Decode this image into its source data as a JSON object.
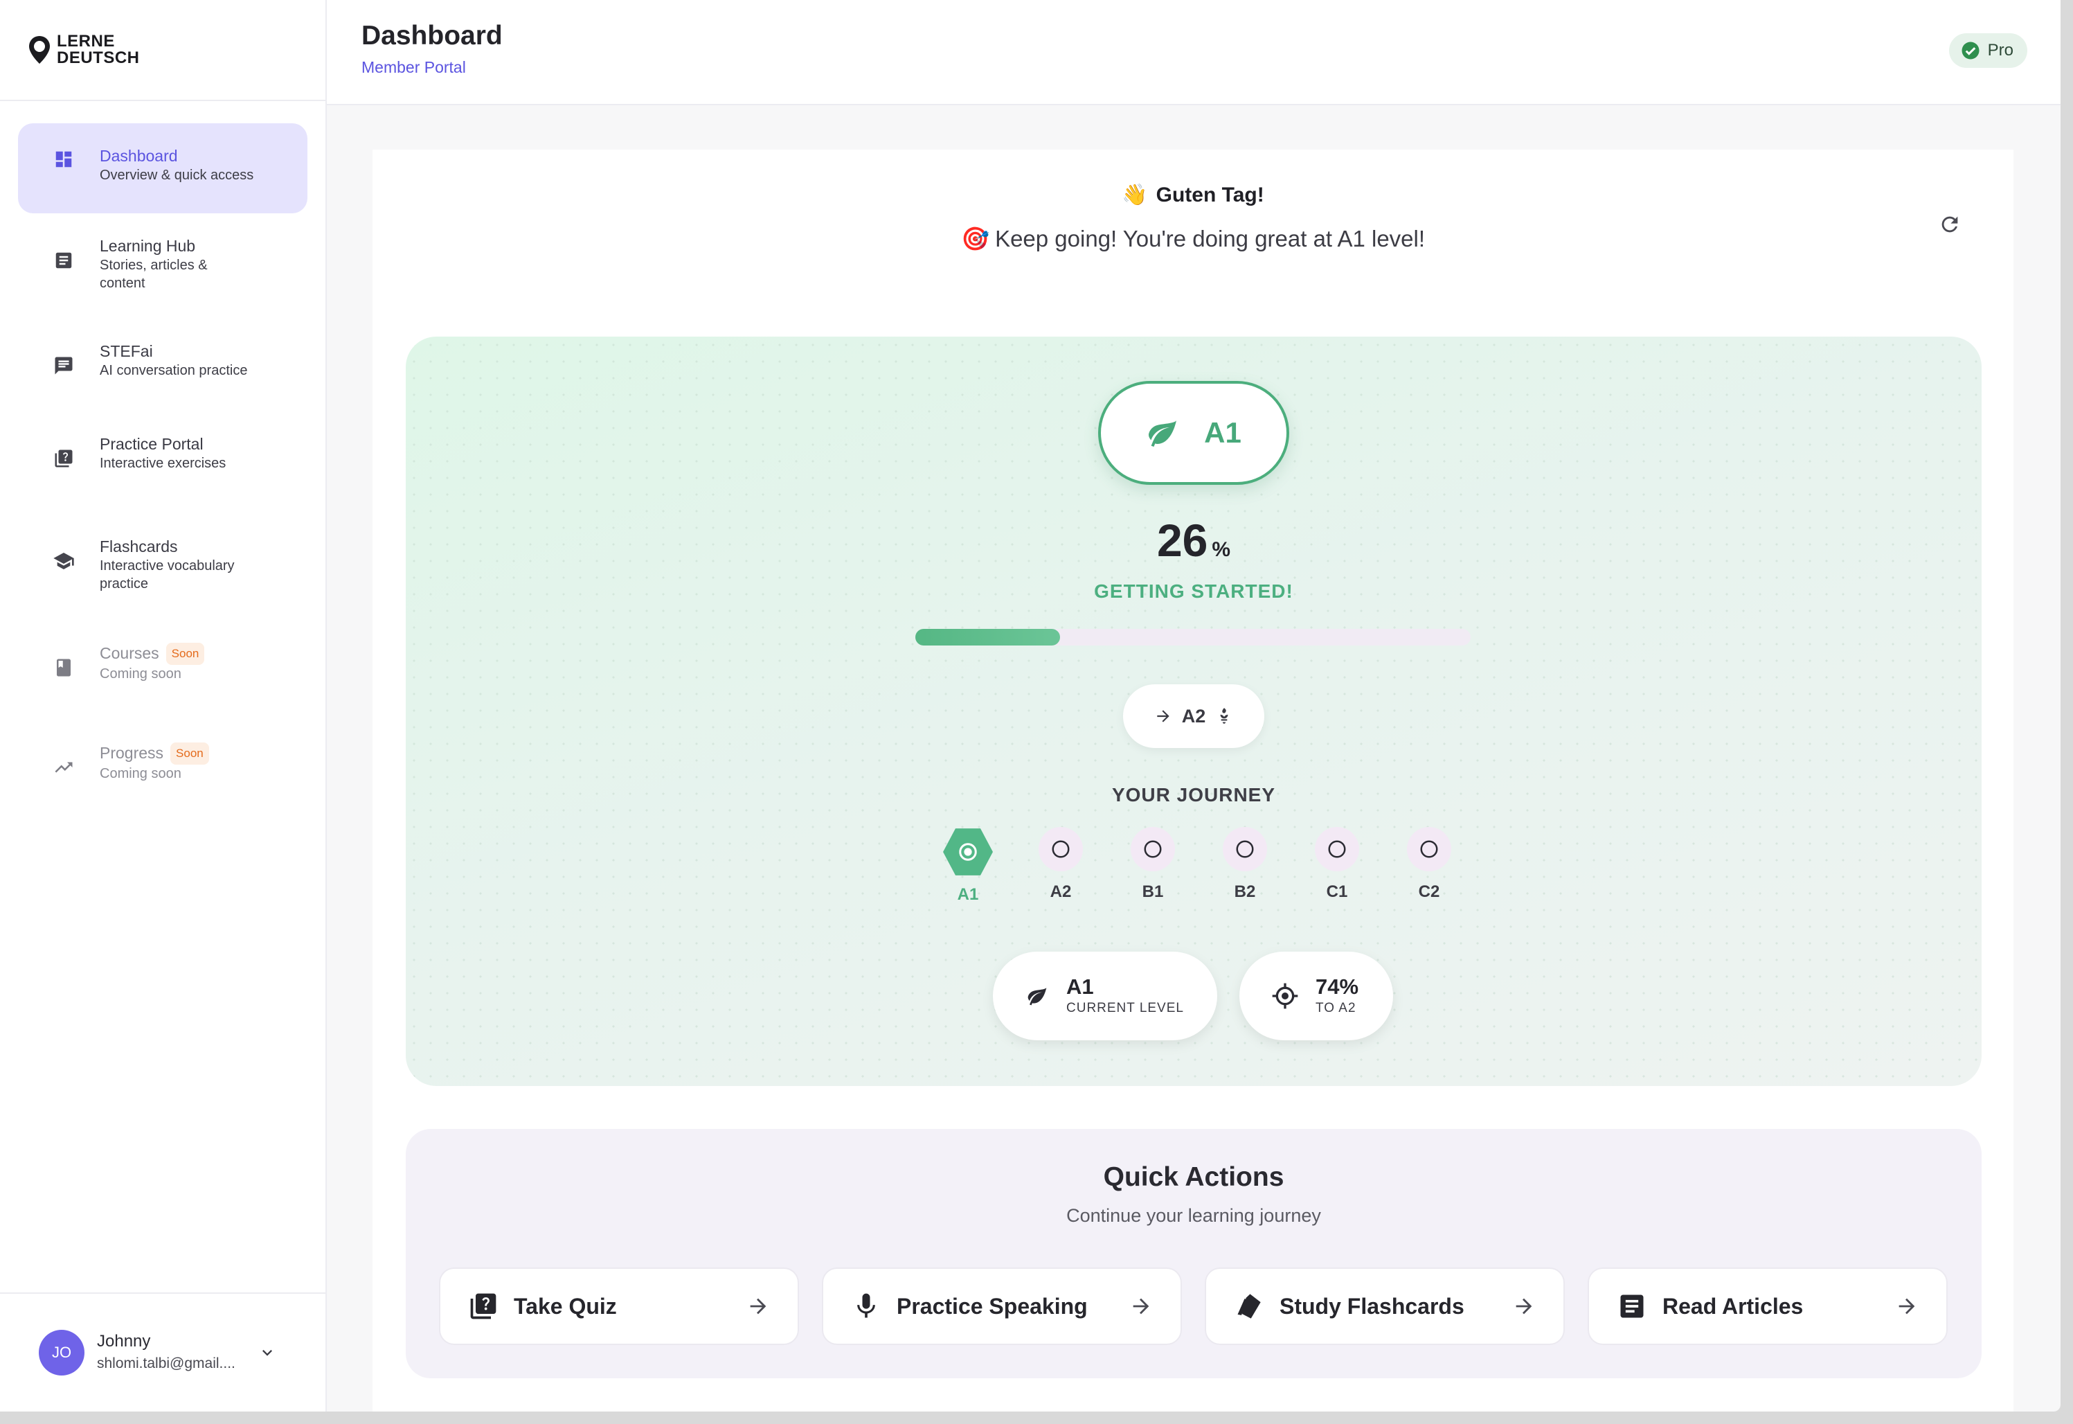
{
  "brand": {
    "line1": "LERNE",
    "line2": "DEUTSCH"
  },
  "sidebar": {
    "items": [
      {
        "title": "Dashboard",
        "sub": "Overview & quick access",
        "icon": "dashboard-icon"
      },
      {
        "title": "Learning Hub",
        "sub": "Stories, articles &",
        "sub2": "content",
        "icon": "article-icon"
      },
      {
        "title": "STEFai",
        "sub": "AI conversation practice",
        "icon": "chat-icon"
      },
      {
        "title": "Practice Portal",
        "sub": "Interactive exercises",
        "icon": "quiz-icon"
      },
      {
        "title": "Flashcards",
        "sub": "Interactive vocabulary",
        "sub2": "practice",
        "icon": "school-icon"
      },
      {
        "title": "Courses",
        "badge": "Soon",
        "sub": "Coming soon",
        "icon": "book-icon"
      },
      {
        "title": "Progress",
        "badge": "Soon",
        "sub": "Coming soon",
        "icon": "trending-icon"
      }
    ]
  },
  "user": {
    "initials": "JO",
    "name": "Johnny",
    "email": "shlomi.talbi@gmail...."
  },
  "header": {
    "title": "Dashboard",
    "subtitle": "Member Portal",
    "badge": "Pro"
  },
  "greeting": {
    "title": "Guten Tag!",
    "message": "Keep going! You're doing great at A1 level!"
  },
  "level": {
    "current": "A1",
    "percent": "26",
    "percent_sign": "%",
    "progress_fraction": 0.26,
    "status": "GETTING STARTED!",
    "next": "A2",
    "journey_title": "YOUR JOURNEY",
    "steps": [
      "A1",
      "A2",
      "B1",
      "B2",
      "C1",
      "C2"
    ],
    "stat_current_value": "A1",
    "stat_current_label": "CURRENT LEVEL",
    "stat_next_value": "74%",
    "stat_next_label": "TO A2"
  },
  "quick_actions": {
    "title": "Quick Actions",
    "subtitle": "Continue your learning journey",
    "items": [
      {
        "label": "Take Quiz",
        "icon": "quiz-icon"
      },
      {
        "label": "Practice Speaking",
        "icon": "mic-icon"
      },
      {
        "label": "Study Flashcards",
        "icon": "cards-icon"
      },
      {
        "label": "Read Articles",
        "icon": "article-icon"
      }
    ]
  },
  "colors": {
    "accent": "#5b54e0",
    "green": "#4caf80",
    "active_bg": "#e5e3fd"
  }
}
